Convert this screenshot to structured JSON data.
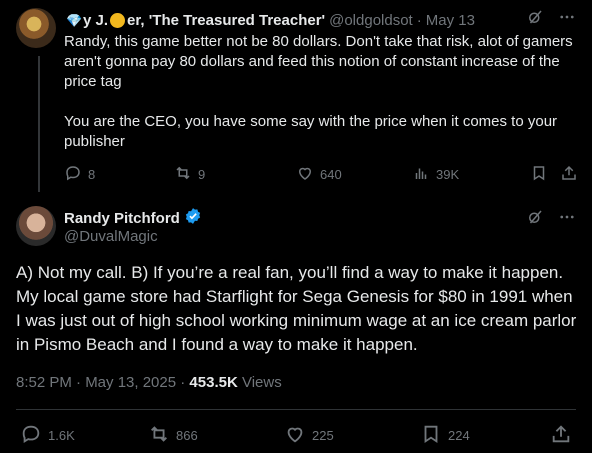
{
  "reply": {
    "author_name": "y J.",
    "author_name_rest": "er, 'The Treasured Treacher'",
    "handle": "@oldgoldsot",
    "sep": "·",
    "date": "May 13",
    "paragraphs": [
      "Randy, this game better not be 80 dollars. Don't take that risk, alot of gamers aren't gonna pay 80 dollars and feed this notion of constant increase of the price tag",
      "You are the CEO, you have some say with the price when it comes to your publisher"
    ],
    "actions": {
      "replies": "8",
      "reposts": "9",
      "likes": "640",
      "views": "39K"
    }
  },
  "main": {
    "author_name": "Randy Pitchford",
    "handle": "@DuvalMagic",
    "body": "A) Not my call. B) If you’re a real fan, you’ll find a way to make it happen. My local game store had Starflight for Sega Genesis for $80 in 1991 when I was just out of high school working minimum wage at an ice cream parlor in Pismo Beach and I found a way to make it happen.",
    "time": "8:52 PM · May 13, 2025 · ",
    "views_count": "453.5K",
    "views_label": " Views",
    "actions": {
      "replies": "1.6K",
      "reposts": "866",
      "likes": "225",
      "bookmarks": "224"
    }
  },
  "colors": {
    "accent": "#1d9bf0",
    "muted": "#71767b",
    "text": "#e7e9ea",
    "background": "#000000"
  }
}
